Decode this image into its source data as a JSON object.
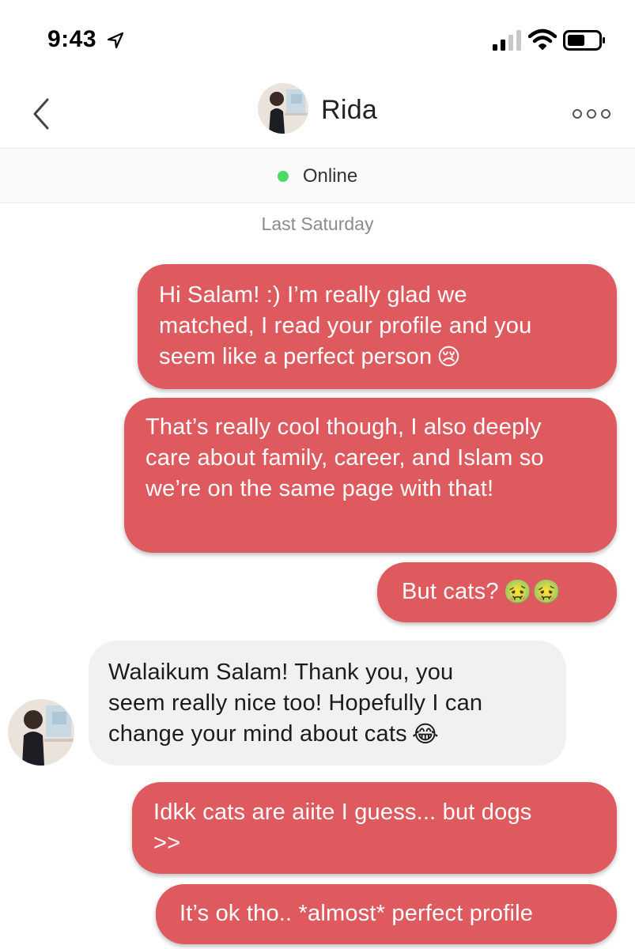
{
  "status_bar": {
    "time": "9:43",
    "icons": [
      "location-arrow-icon",
      "cellular-signal-icon",
      "wifi-icon",
      "battery-icon"
    ]
  },
  "header": {
    "contact_name": "Rida",
    "back_icon": "chevron-left-icon",
    "more_icon": "ellipsis-icon"
  },
  "presence": {
    "status": "Online",
    "dot_color": "#4cd964"
  },
  "date_separator": "Last Saturday",
  "colors": {
    "sent_bubble": "#de5a5f",
    "received_bubble": "#f1f1f3"
  },
  "messages": [
    {
      "direction": "sent",
      "lines": [
        "Hi Salam! :) I’m really glad we",
        "matched, I read your profile and you",
        "seem like a perfect person"
      ],
      "emoji": "😢"
    },
    {
      "direction": "sent",
      "lines": [
        "That’s really cool though, I also deeply",
        "care about family, career, and Islam so",
        "we’re on the same page with that!"
      ]
    },
    {
      "direction": "sent",
      "lines": [
        "But cats?"
      ],
      "emoji": "🤢🤢"
    },
    {
      "direction": "received",
      "lines": [
        "Walaikum Salam! Thank you, you",
        "seem really nice too! Hopefully I can",
        "change your mind about cats"
      ],
      "emoji": "😂"
    },
    {
      "direction": "sent",
      "lines": [
        "Idkk cats are aiite I guess... but dogs",
        ">>"
      ]
    },
    {
      "direction": "sent",
      "lines": [
        "It’s ok tho.. *almost* perfect profile"
      ]
    }
  ]
}
